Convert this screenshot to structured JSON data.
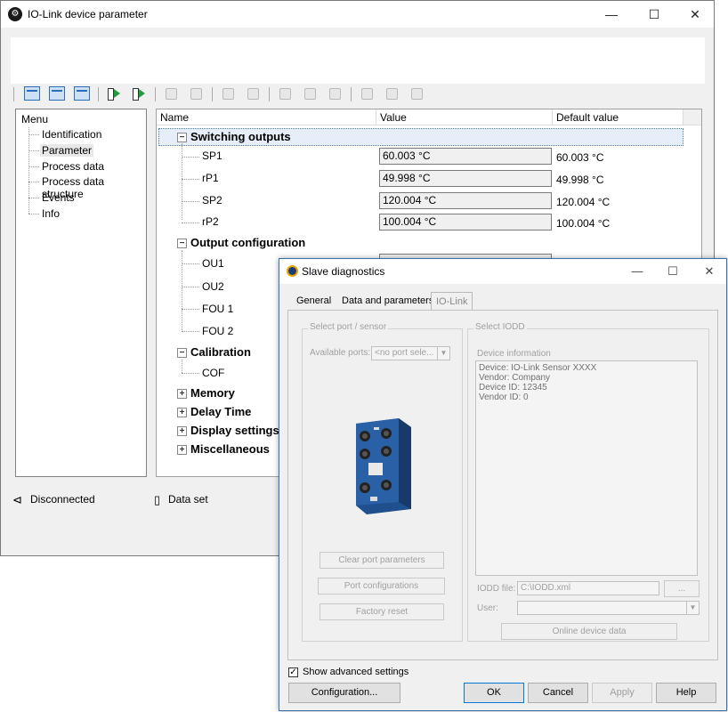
{
  "main_window": {
    "title": "IO-Link device parameter",
    "controls": {
      "minimize": "—",
      "maximize": "☐",
      "close": "✕"
    },
    "menu": {
      "title": "Menu",
      "items": [
        "Identification",
        "Parameter",
        "Process data",
        "Process data structure",
        "Events",
        "Info"
      ],
      "selected": "Parameter"
    },
    "grid": {
      "columns": [
        "Name",
        "Value",
        "Default value"
      ],
      "groups": {
        "switching": {
          "label": "Switching outputs",
          "expander": "−"
        },
        "output_config": {
          "label": "Output configuration",
          "expander": "−"
        },
        "calibration": {
          "label": "Calibration",
          "expander": "−"
        },
        "memory": {
          "label": "Memory",
          "expander": "+"
        },
        "delay": {
          "label": "Delay Time",
          "expander": "+"
        },
        "display": {
          "label": "Display settings",
          "expander": "+"
        },
        "misc": {
          "label": "Miscellaneous",
          "expander": "+"
        }
      },
      "switching_params": [
        {
          "name": "SP1",
          "value": "60.003 °C",
          "default": "60.003 °C"
        },
        {
          "name": "rP1",
          "value": "49.998 °C",
          "default": "49.998 °C"
        },
        {
          "name": "SP2",
          "value": "120.004 °C",
          "default": "120.004 °C"
        },
        {
          "name": "rP2",
          "value": "100.004 °C",
          "default": "100.004 °C"
        }
      ],
      "output_params": [
        "OU1",
        "OU2",
        "FOU 1",
        "FOU 2"
      ],
      "calibration_params": [
        "COF"
      ]
    },
    "status": {
      "connection": "Disconnected",
      "dataset": "Data set"
    }
  },
  "dialog": {
    "title": "Slave diagnostics",
    "controls": {
      "minimize": "—",
      "maximize": "☐",
      "close": "✕"
    },
    "tabs": [
      "General",
      "Data and parameters",
      "IO-Link"
    ],
    "active_tab": "IO-Link",
    "port_group": {
      "label": "Select port / sensor",
      "available_ports_label": "Available ports:",
      "available_ports_value": "<no port sele...",
      "clear_button": "Clear port parameters",
      "port_config_button": "Port configurations",
      "factory_reset_button": "Factory reset"
    },
    "iodd_group": {
      "label": "Select IODD",
      "device_info_label": "Device information",
      "device_info_lines": [
        "Device: IO-Link Sensor XXXX",
        "Vendor: Company",
        "Device ID: 12345",
        "Vendor ID: 0"
      ],
      "iodd_file_label": "IODD file:",
      "iodd_file_value": "C:\\IODD.xml",
      "browse_button": "...",
      "user_label": "User:",
      "online_button": "Online device data"
    },
    "show_advanced": {
      "label": "Show advanced settings",
      "checked": true,
      "mark": "✓"
    },
    "buttons": {
      "configuration": "Configuration...",
      "ok": "OK",
      "cancel": "Cancel",
      "apply": "Apply",
      "help": "Help"
    }
  },
  "colors": {
    "accent": "#0078d7",
    "selection": "#e6eef9",
    "device_blue": "#1c3b78"
  }
}
